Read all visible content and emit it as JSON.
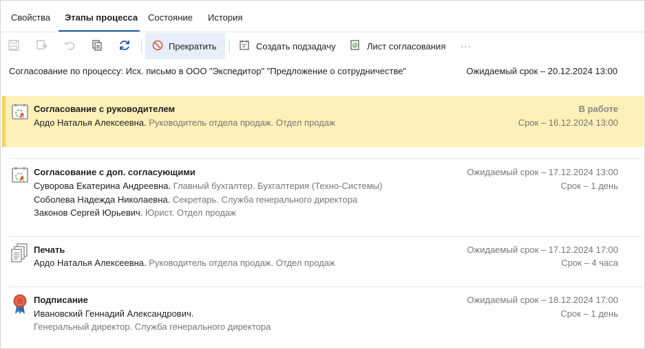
{
  "tabs": [
    {
      "label": "Свойства",
      "active": false
    },
    {
      "label": "Этапы процесса",
      "active": true
    },
    {
      "label": "Состояние",
      "active": false
    },
    {
      "label": "История",
      "active": false
    }
  ],
  "toolbar": {
    "stop_label": "Прекратить",
    "create_subtask_label": "Создать подзадачу",
    "approval_sheet_label": "Лист согласования",
    "more_label": "···"
  },
  "process": {
    "title": "Согласование по процессу: Исх. письмо в ООО \"Экспедитор\" \"Предложение о сотрудничестве\"",
    "due": "Ожидаемый срок – 20.12.2024 13:00"
  },
  "stages": [
    {
      "title": "Согласование с руководителем",
      "status": "В работе",
      "deadline": "Срок – 16.12.2024 13:00",
      "participants": [
        {
          "name": "Ардо Наталья Алексеевна.",
          "role": "Руководитель отдела продаж. Отдел продаж"
        }
      ]
    },
    {
      "title": "Согласование с доп. согласующими",
      "due": "Ожидаемый срок – 17.12.2024 13:00",
      "duration": "Срок – 1 день",
      "participants": [
        {
          "name": "Суворова Екатерина Андреевна.",
          "role": "Главный бухгалтер. Бухгалтерия (Техно-Системы)"
        },
        {
          "name": "Соболева Надежда Николаевна.",
          "role": "Секретарь. Служба генерального директора"
        },
        {
          "name": "Законов Сергей Юрьевич.",
          "role": "Юрист. Отдел продаж"
        }
      ]
    },
    {
      "title": "Печать",
      "due": "Ожидаемый срок – 17.12.2024 17:00",
      "duration": "Срок – 4 часа",
      "participants": [
        {
          "name": "Ардо Наталья Алексеевна.",
          "role": "Руководитель отдела продаж. Отдел продаж"
        }
      ]
    },
    {
      "title": "Подписание",
      "due": "Ожидаемый срок – 18.12.2024 17:00",
      "duration": "Срок – 1 день",
      "participants": [
        {
          "name": "Ивановский Геннадий Александрович.",
          "role": "Генеральный директор. Служба генерального директора"
        }
      ]
    }
  ],
  "colors": {
    "accent": "#1e5aa8",
    "active_stage_bg": "#fdf0b8",
    "active_stage_border": "#f3d35a",
    "stop_icon": "#e0533a",
    "signing_icon": "#d9553a"
  }
}
